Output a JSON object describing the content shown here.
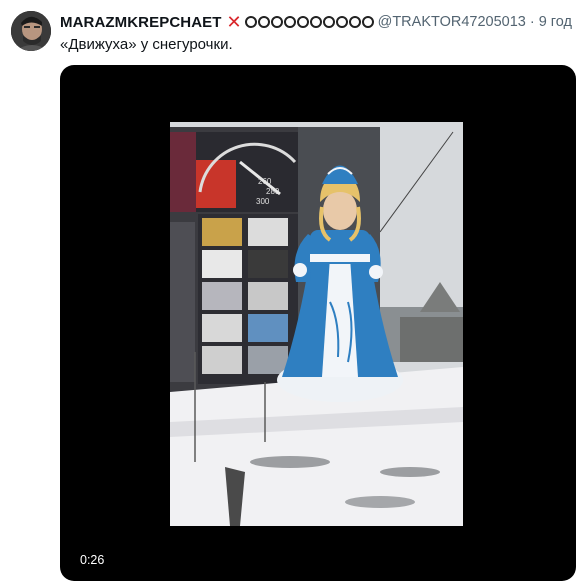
{
  "tweet": {
    "display_name": "MARAZMKREPCHAET",
    "handle": "@TRAKTOR47205013",
    "separator": "·",
    "time": "9 год",
    "text": "«Движуха» у снегурочки.",
    "x_mark": "✕"
  },
  "media": {
    "duration": "0:26",
    "speedometer_labels": [
      "260",
      "280",
      "300"
    ]
  },
  "colors": {
    "name": "#0f1419",
    "meta": "#536471",
    "x_mark": "#d9262b",
    "media_bg": "#000000",
    "snegurochka_blue": "#2f7fc1"
  },
  "icons": {
    "verified_marks": "x-mark-icon",
    "emoji_row": "circle-emoji-icons",
    "avatar": "avatar-photo"
  }
}
